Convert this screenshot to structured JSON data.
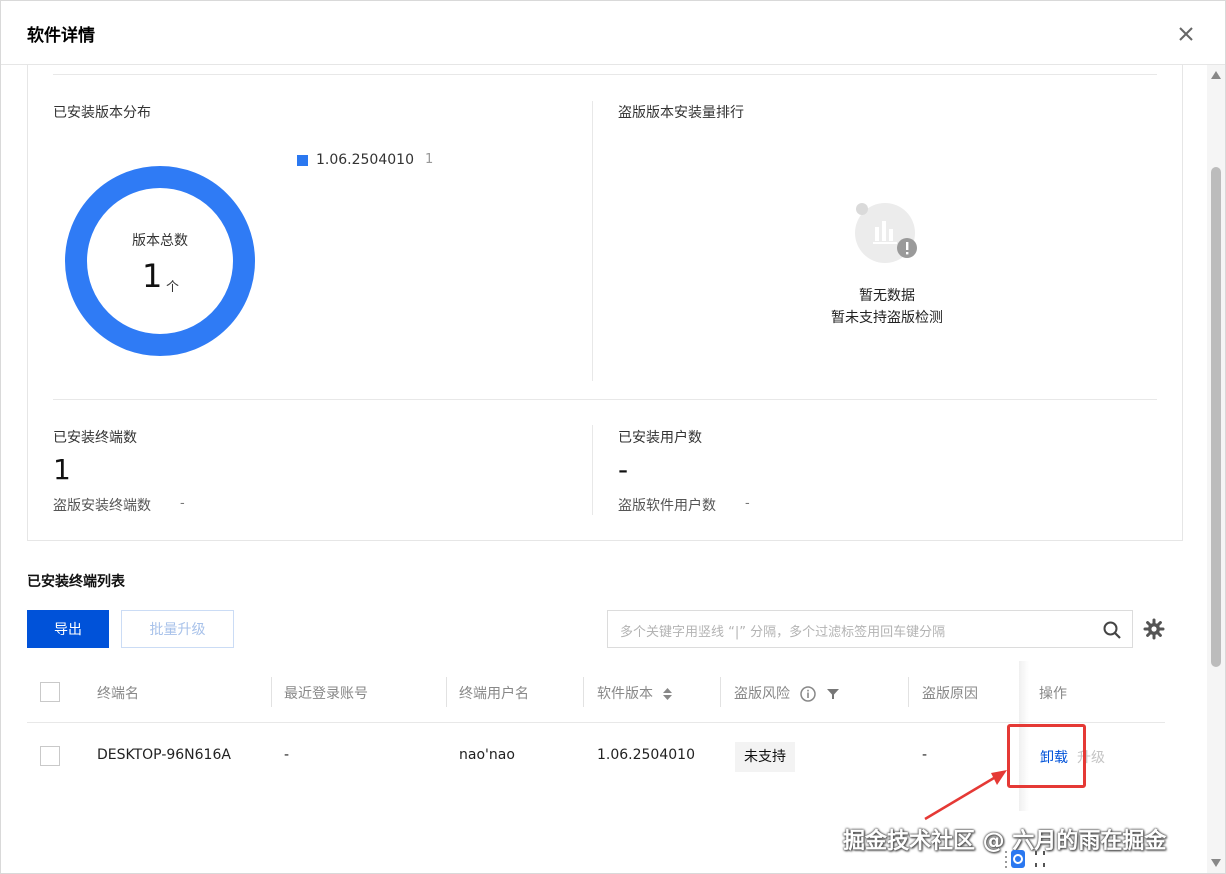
{
  "dialog": {
    "title": "软件详情"
  },
  "version_distribution": {
    "label": "已安装版本分布",
    "legend_item": "1.06.2504010",
    "legend_count": "1",
    "center_label": "版本总数",
    "center_value": "1",
    "center_unit": "个",
    "color": "#2f7bf5"
  },
  "piracy_ranking": {
    "label": "盗版版本安装量排行",
    "empty_title": "暂无数据",
    "empty_desc": "暂未支持盗版检测"
  },
  "terminals": {
    "label": "已安装终端数",
    "value": "1",
    "sub_label": "盗版安装终端数",
    "sub_value": "-"
  },
  "users": {
    "label": "已安装用户数",
    "value": "-",
    "sub_label": "盗版软件用户数",
    "sub_value": "-"
  },
  "list": {
    "title": "已安装终端列表",
    "export_label": "导出",
    "batch_upgrade_label": "批量升级",
    "search_placeholder": "多个关键字用竖线 “|” 分隔，多个过滤标签用回车键分隔"
  },
  "table": {
    "headers": {
      "terminal_name": "终端名",
      "last_login": "最近登录账号",
      "terminal_user": "终端用户名",
      "software_version": "软件版本",
      "piracy_risk": "盗版风险",
      "piracy_reason": "盗版原因",
      "actions": "操作"
    },
    "rows": [
      {
        "terminal_name": "DESKTOP-96N616A",
        "last_login": "-",
        "terminal_user": "nao'nao",
        "software_version": "1.06.2504010",
        "piracy_risk": "未支持",
        "piracy_reason": "-",
        "action_uninstall": "卸载",
        "action_upgrade": "升级"
      }
    ]
  },
  "watermark": "掘金技术社区 @ 六月的雨在掘金",
  "colors": {
    "primary": "#0052d9",
    "highlight": "#e53935"
  }
}
